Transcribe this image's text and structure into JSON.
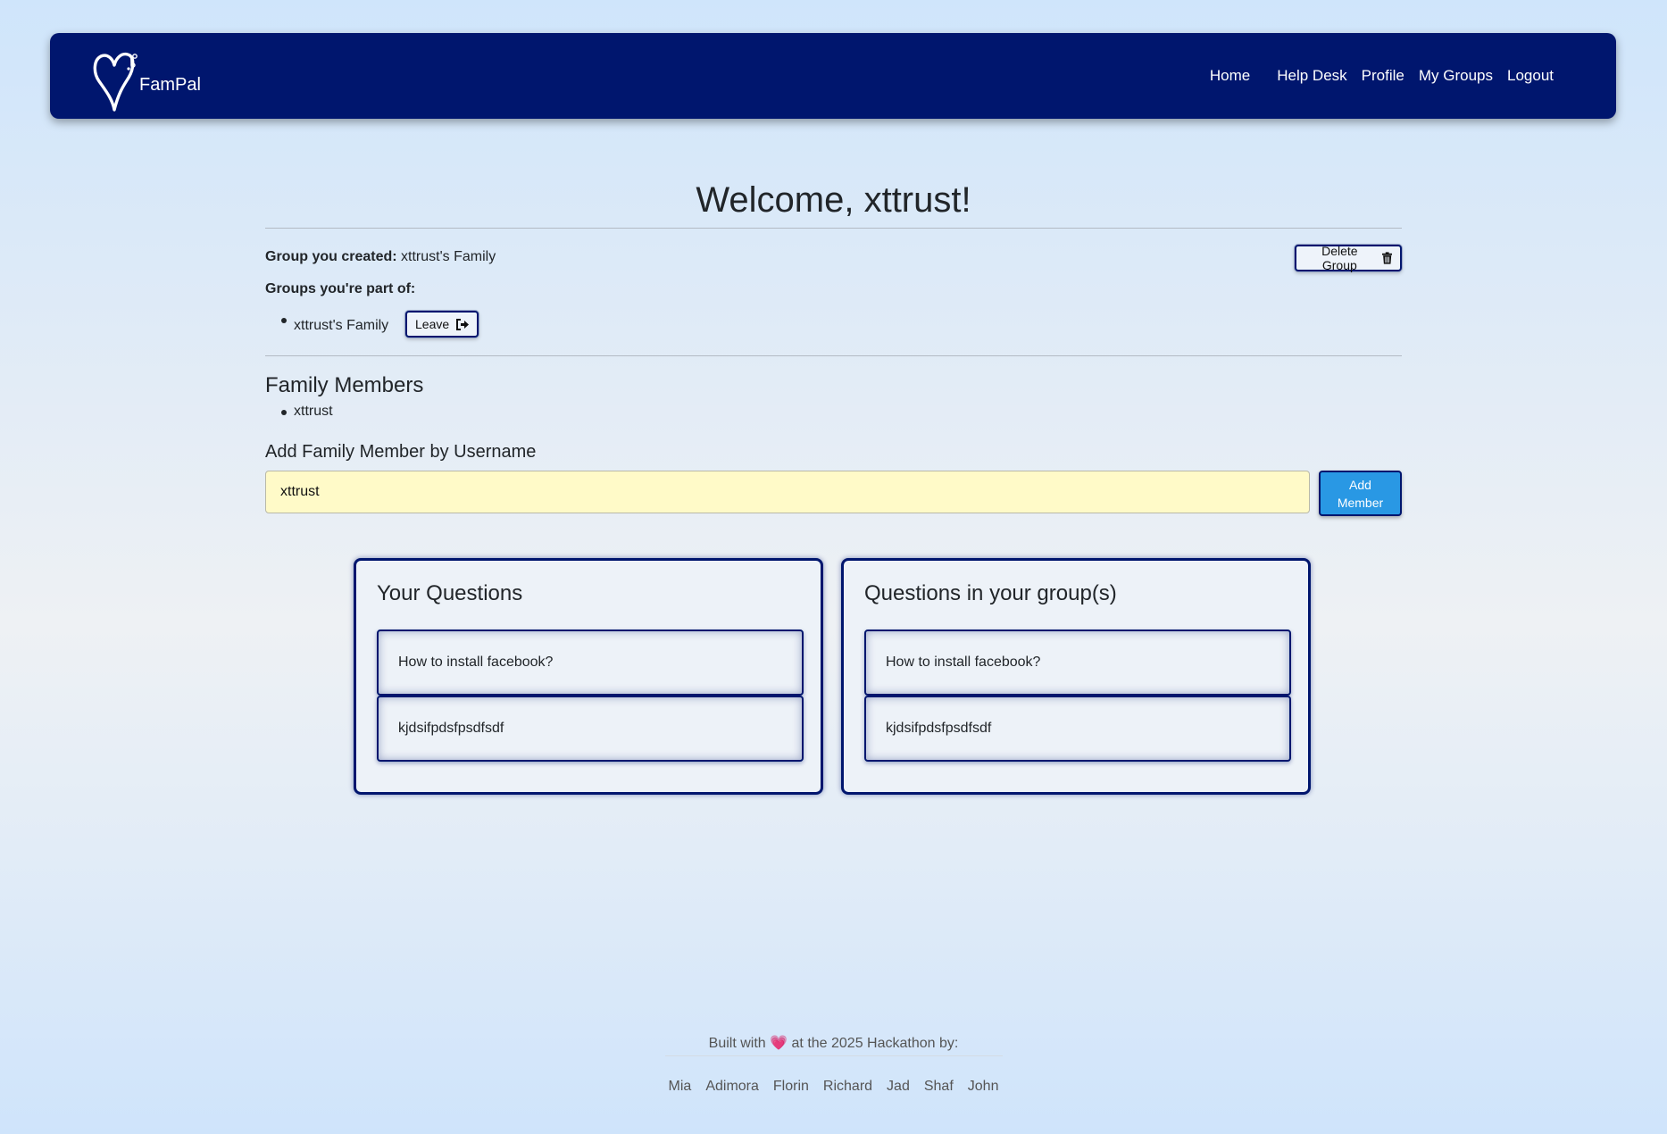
{
  "navbar": {
    "brand": "FamPal",
    "links": [
      "Home",
      "Help Desk",
      "Profile",
      "My Groups",
      "Logout"
    ]
  },
  "main": {
    "welcome": "Welcome, xttrust!",
    "group_created_label": "Group you created:",
    "group_created_value": "xttrust's Family",
    "delete_group_label": "Delete Group",
    "groups_part_of_label": "Groups you're part of:",
    "groups": [
      {
        "name": "xttrust's Family",
        "leave_label": "Leave"
      }
    ],
    "family_members_heading": "Family Members",
    "family_members": [
      "xttrust"
    ],
    "add_member_heading": "Add Family Member by Username",
    "add_member_input_value": "xttrust",
    "add_member_button_line1": "Add",
    "add_member_button_line2": "Member"
  },
  "your_questions": {
    "title": "Your Questions",
    "items": [
      "How to install facebook?",
      "kjdsifpdsfpsdfsdf"
    ]
  },
  "group_questions": {
    "title": "Questions in your group(s)",
    "items": [
      "How to install facebook?",
      "kjdsifpdsfpsdfsdf"
    ]
  },
  "footer": {
    "built_prefix": "Built with",
    "heart": "💗",
    "built_suffix": "at the 2025 Hackathon by:",
    "names": [
      "Mia",
      "Adimora",
      "Florin",
      "Richard",
      "Jad",
      "Shaf",
      "John"
    ]
  },
  "colors": {
    "navbar_bg": "#00166e",
    "accent_blue": "#2998e4",
    "input_bg": "#fffac8"
  },
  "icons": {
    "logo": "heart-logo-icon",
    "delete": "trash-icon",
    "leave": "sign-out-icon"
  }
}
